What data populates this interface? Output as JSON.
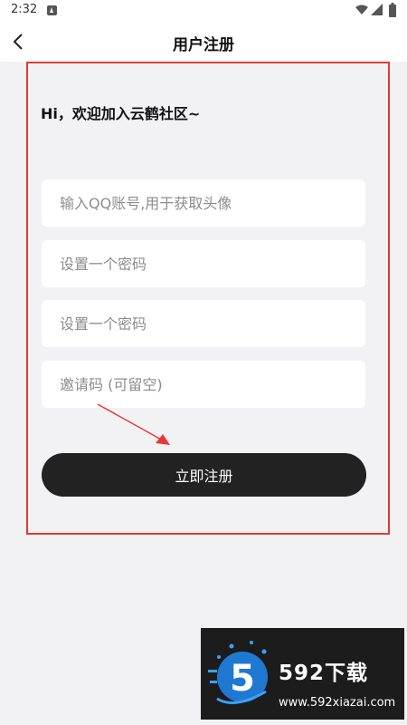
{
  "status_bar": {
    "time": "2:32",
    "icons": [
      "a-app-icon",
      "wifi-icon",
      "signal-icon",
      "battery-icon"
    ]
  },
  "header": {
    "back_icon": "chevron-left-icon",
    "title": "用户注册"
  },
  "form": {
    "welcome": "Hi，欢迎加入云鹤社区~",
    "qq_placeholder": "输入QQ账号,用于获取头像",
    "password_placeholder": "设置一个密码",
    "confirm_password_placeholder": "设置一个密码",
    "invite_placeholder": "邀请码 (可留空)",
    "submit_label": "立即注册"
  },
  "watermark": {
    "logo_digit": "5",
    "brand": "592下载",
    "url": "www.592xiazai.com"
  },
  "colors": {
    "background": "#f2f2f4",
    "button": "#222222",
    "annotation": "#e53935"
  }
}
